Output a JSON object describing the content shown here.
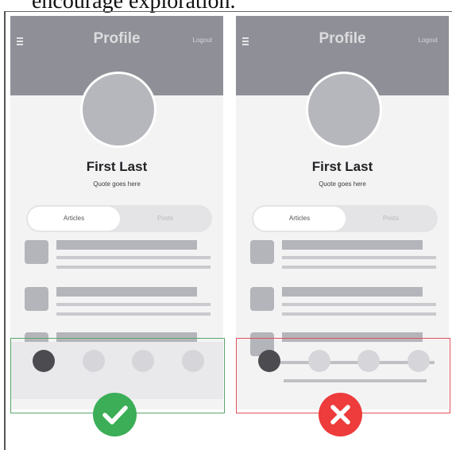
{
  "caption": "encourage exploration.",
  "panels": {
    "left": {
      "header_title": "Profile",
      "logout_label": "Logout",
      "name": "First Last",
      "quote": "Quote goes here",
      "tabs": [
        "Articles",
        "Posts"
      ]
    },
    "right": {
      "header_title": "Profile",
      "logout_label": "Logout",
      "name": "First Last",
      "quote": "Quote goes here",
      "tabs": [
        "Articles",
        "Posts"
      ]
    }
  },
  "icons": {
    "good": "checkmark-icon",
    "bad": "cross-icon"
  },
  "colors": {
    "header": "#8f9097",
    "good_frame": "#5aa66b",
    "bad_frame": "#e0505a",
    "good_badge": "#3bae57",
    "bad_badge": "#ee3b3b",
    "active_dot": "#4b4b50"
  }
}
